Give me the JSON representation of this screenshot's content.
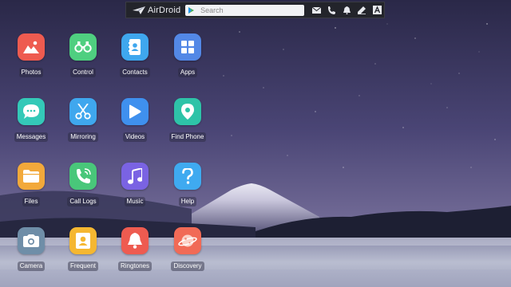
{
  "topbar": {
    "logo_text": "AirDroid",
    "search_placeholder": "Search",
    "icons": [
      "mail-icon",
      "phone-icon",
      "bell-icon",
      "pen-icon",
      "text-icon"
    ]
  },
  "apps": [
    {
      "label": "Photos",
      "icon": "photos-icon",
      "color": "#ee5b50"
    },
    {
      "label": "Control",
      "icon": "binoculars-icon",
      "color": "#4fcf80"
    },
    {
      "label": "Contacts",
      "icon": "contacts-icon",
      "color": "#3fa7ee"
    },
    {
      "label": "Apps",
      "icon": "apps-grid-icon",
      "color": "#5388e6"
    },
    {
      "label": "Messages",
      "icon": "chat-bubble-icon",
      "color": "#34c9b8"
    },
    {
      "label": "Mirroring",
      "icon": "scissors-icon",
      "color": "#3fa7ee"
    },
    {
      "label": "Videos",
      "icon": "play-icon",
      "color": "#3f90ee"
    },
    {
      "label": "Find Phone",
      "icon": "location-pin-icon",
      "color": "#2ec3a8"
    },
    {
      "label": "Files",
      "icon": "folder-icon",
      "color": "#f2a93b"
    },
    {
      "label": "Call Logs",
      "icon": "phone-call-icon",
      "color": "#49c77a"
    },
    {
      "label": "Music",
      "icon": "music-note-icon",
      "color": "#7a63e3"
    },
    {
      "label": "Help",
      "icon": "question-icon",
      "color": "#3faaf0"
    },
    {
      "label": "Camera",
      "icon": "camera-icon",
      "color": "#6f8ea8"
    },
    {
      "label": "Frequent",
      "icon": "frequent-contact-icon",
      "color": "#f5b731"
    },
    {
      "label": "Ringtones",
      "icon": "bell-ring-icon",
      "color": "#ee5b50"
    },
    {
      "label": "Discovery",
      "icon": "planet-icon",
      "color": "#f16a56"
    }
  ]
}
